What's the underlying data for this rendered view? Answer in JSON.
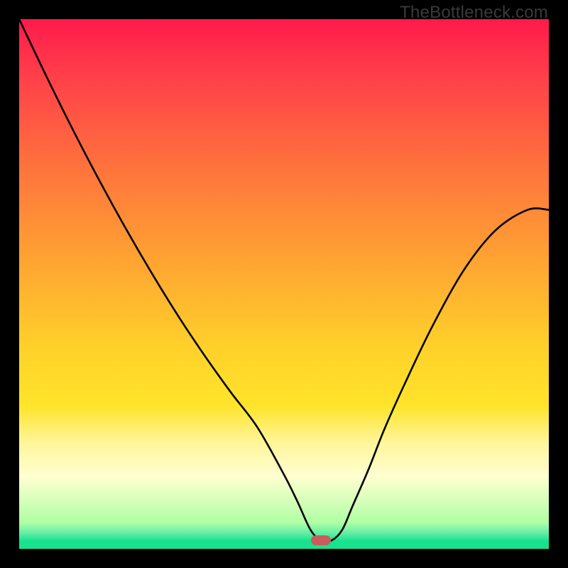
{
  "attribution": "TheBottleneck.com",
  "colors": {
    "frame": "#000000",
    "curve": "#000000",
    "marker": "#c95d5d"
  },
  "chart_data": {
    "type": "line",
    "title": "",
    "xlabel": "",
    "ylabel": "",
    "xlim": [
      0,
      100
    ],
    "ylim": [
      0,
      100
    ],
    "grid": false,
    "legend": false,
    "background": {
      "type": "vertical_gradient",
      "stops": [
        {
          "pos": 0.0,
          "color": "#ff1a4b"
        },
        {
          "pos": 0.25,
          "color": "#ff6a3f"
        },
        {
          "pos": 0.5,
          "color": "#ffc22d"
        },
        {
          "pos": 0.75,
          "color": "#ffee5e"
        },
        {
          "pos": 0.9,
          "color": "#ffffd0"
        },
        {
          "pos": 1.0,
          "color": "#19e28e"
        }
      ]
    },
    "series": [
      {
        "name": "bottleneck-curve",
        "x": [
          0.0,
          5.0,
          10.0,
          15.0,
          20.0,
          25.0,
          30.0,
          35.0,
          40.0,
          45.0,
          50.0,
          52.5,
          55.0,
          57.0,
          59.0,
          61.0,
          63.0,
          66.0,
          69.0,
          73.0,
          78.0,
          84.0,
          90.0,
          96.0,
          100.0
        ],
        "values": [
          100.0,
          89.5,
          79.4,
          69.8,
          60.7,
          52.1,
          44.0,
          36.5,
          29.5,
          22.9,
          14.0,
          9.0,
          3.6,
          1.6,
          1.6,
          3.6,
          8.2,
          15.1,
          22.7,
          31.6,
          42.0,
          52.7,
          60.2,
          64.0,
          64.0
        ]
      }
    ],
    "marker": {
      "name": "optimum-marker",
      "x": 57.0,
      "y": 1.6,
      "shape": "pill",
      "color": "#c95d5d"
    }
  }
}
